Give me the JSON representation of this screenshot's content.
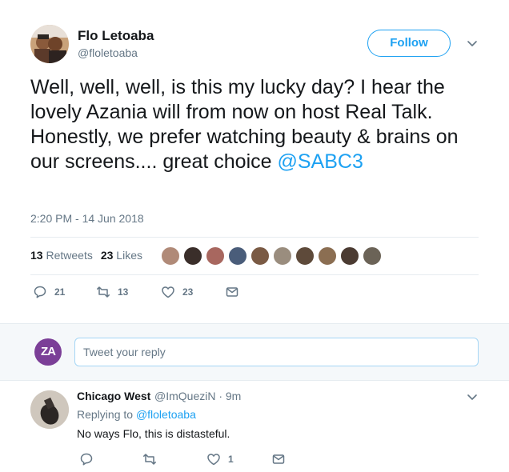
{
  "tweet": {
    "name": "Flo Letoaba",
    "handle": "@floletoaba",
    "follow_label": "Follow",
    "text_main": "Well, well, well, is this my lucky day? I hear the lovely Azania will from now on host Real Talk. Honestly, we prefer watching beauty & brains on our screens.... great choice ",
    "text_mention": "@SABC3",
    "time": "2:20 PM - 14 Jun 2018",
    "retweets_count": "13",
    "retweets_label": "Retweets",
    "likes_count": "23",
    "likes_label": "Likes",
    "actions": {
      "reply_count": "21",
      "retweet_count": "13",
      "like_count": "23"
    }
  },
  "reply_bar": {
    "avatar_text": "ZA",
    "placeholder": "Tweet your reply",
    "colors": {
      "avatar_bg": "#7b3f97"
    }
  },
  "reply": {
    "name": "Chicago West",
    "handle": "@ImQueziN · 9m",
    "replying_prefix": "Replying to ",
    "replying_to": "@floletoaba",
    "text": "No ways Flo, this is distasteful.",
    "actions": {
      "like_count": "1"
    }
  },
  "colors": {
    "accent": "#1da1f2",
    "muted": "#657786",
    "text": "#14171a"
  },
  "icons": [
    "reply-icon",
    "retweet-icon",
    "heart-icon",
    "message-icon",
    "chevron-down-icon"
  ]
}
